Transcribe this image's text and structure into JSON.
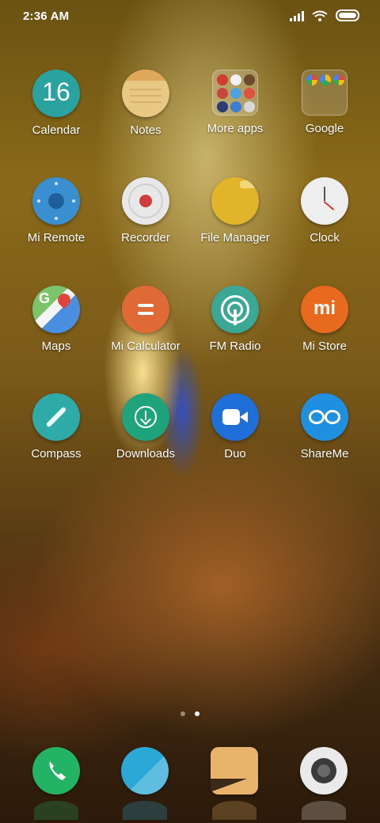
{
  "status_bar": {
    "time": "2:36 AM"
  },
  "apps": [
    {
      "label": "Calendar",
      "icon": "calendar-icon",
      "badge_text": "16"
    },
    {
      "label": "Notes",
      "icon": "notes-icon"
    },
    {
      "label": "More apps",
      "icon": "folder-icon"
    },
    {
      "label": "Google",
      "icon": "folder-icon"
    },
    {
      "label": "Mi Remote",
      "icon": "remote-icon"
    },
    {
      "label": "Recorder",
      "icon": "recorder-icon"
    },
    {
      "label": "File Manager",
      "icon": "folder-file-icon"
    },
    {
      "label": "Clock",
      "icon": "clock-icon"
    },
    {
      "label": "Maps",
      "icon": "maps-icon"
    },
    {
      "label": "Mi Calculator",
      "icon": "calculator-icon"
    },
    {
      "label": "FM Radio",
      "icon": "radio-icon"
    },
    {
      "label": "Mi Store",
      "icon": "mi-store-icon",
      "badge_text": "mi"
    },
    {
      "label": "Compass",
      "icon": "compass-icon"
    },
    {
      "label": "Downloads",
      "icon": "download-icon"
    },
    {
      "label": "Duo",
      "icon": "video-camera-icon"
    },
    {
      "label": "ShareMe",
      "icon": "infinity-icon"
    }
  ],
  "page_indicator": {
    "count": 2,
    "active_index": 1
  },
  "dock": [
    {
      "icon": "phone-icon"
    },
    {
      "icon": "messaging-icon"
    },
    {
      "icon": "gallery-icon"
    },
    {
      "icon": "camera-icon"
    }
  ],
  "colors": {
    "calendar": "#2aa3a0",
    "notes": "#e9c883",
    "remote": "#3a8fd1",
    "recorder": "#e8e8e8",
    "file_manager": "#e2b42a",
    "clock": "#eeeeee",
    "calculator": "#e06a35",
    "radio": "#3aa894",
    "mi_store": "#e86a1f",
    "compass": "#2eaaa8",
    "downloads": "#1fa37a",
    "duo": "#1f6fd9",
    "shareme": "#1f8fe0",
    "phone": "#22b365",
    "messaging": "#2aa8d6",
    "gallery": "#e8b36a",
    "camera": "#eaeaea"
  }
}
